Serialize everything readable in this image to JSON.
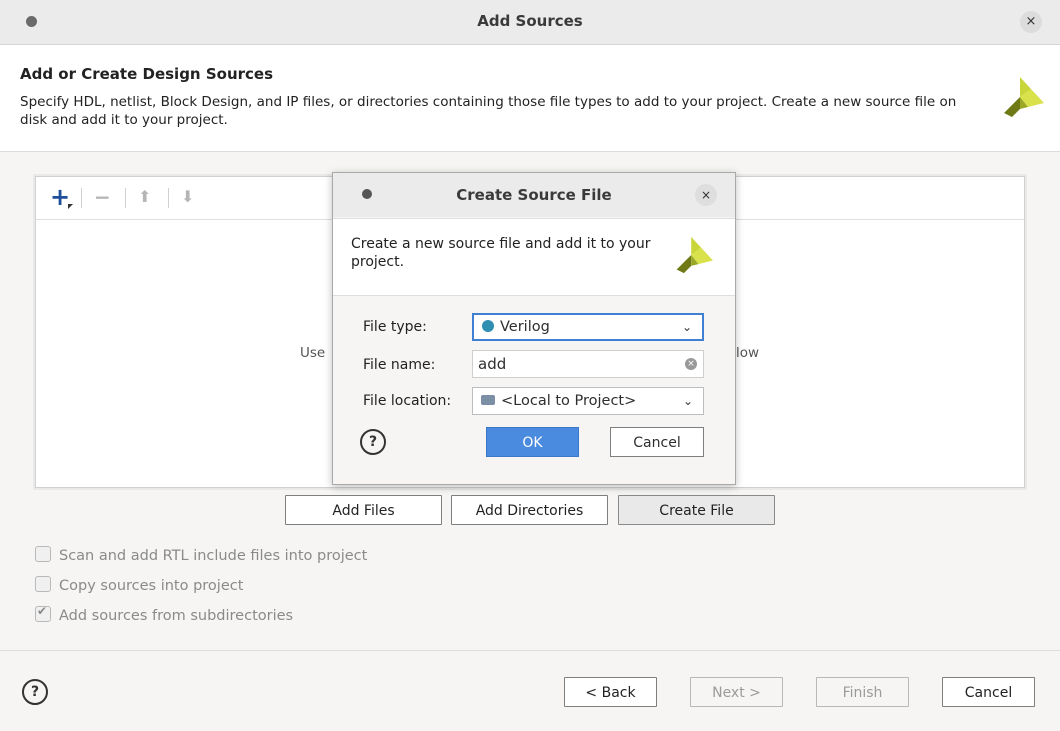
{
  "window": {
    "title": "Add Sources",
    "close_glyph": "×"
  },
  "header": {
    "title": "Add or Create Design Sources",
    "description": "Specify HDL, netlist, Block Design, and IP files, or directories containing those file types to add to your project. Create a new source file on disk and add it to your project."
  },
  "toolbar": {
    "add_glyph": "+",
    "remove_glyph": "−",
    "up_glyph": "⬆",
    "down_glyph": "⬇"
  },
  "panel": {
    "hint_left": "Use",
    "hint_right": "low"
  },
  "actions": {
    "add_files": "Add Files",
    "add_directories": "Add Directories",
    "create_file": "Create File"
  },
  "options": [
    {
      "label": "Scan and add RTL include files into project",
      "checked": false
    },
    {
      "label": "Copy sources into project",
      "checked": false
    },
    {
      "label": "Add sources from subdirectories",
      "checked": true
    }
  ],
  "footer": {
    "help": "?",
    "back": "< Back",
    "next": "Next >",
    "finish": "Finish",
    "cancel": "Cancel"
  },
  "dialog": {
    "title": "Create Source File",
    "close_glyph": "×",
    "description": "Create a new source file and add it to your project.",
    "file_type_label": "File type:",
    "file_type_value": "Verilog",
    "file_name_label": "File name:",
    "file_name_value": "add",
    "file_location_label": "File location:",
    "file_location_value": "<Local to Project>",
    "help": "?",
    "ok": "OK",
    "cancel": "Cancel"
  },
  "colors": {
    "accent": "#4a8be0",
    "verilog_dot": "#2e8fb3",
    "logo_light": "#c9d63a",
    "logo_dark": "#6f7a17"
  }
}
